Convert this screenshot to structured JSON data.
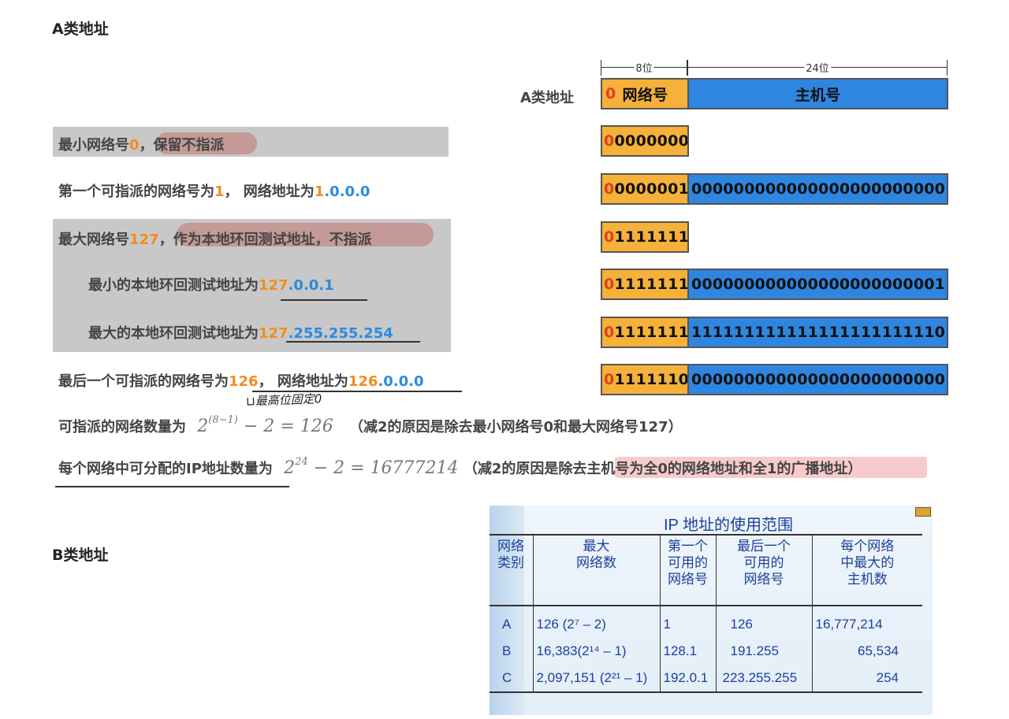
{
  "section_a_title": "A类地址",
  "section_b_title": "B类地址",
  "diagram": {
    "label": "A类地址",
    "dim_net": "8位",
    "dim_host": "24位",
    "header_net_prefix": "0",
    "header_net": "网络号",
    "header_host": "主机号",
    "rows": [
      {
        "net_first": "0",
        "net_rest": "0000000",
        "host": ""
      },
      {
        "net_first": "0",
        "net_rest": "0000001",
        "host": "000000000000000000000000"
      },
      {
        "net_first": "0",
        "net_rest": "1111111",
        "host": ""
      },
      {
        "net_first": "0",
        "net_rest": "1111111",
        "host": "000000000000000000000001"
      },
      {
        "net_first": "0",
        "net_rest": "1111111",
        "host": "111111111111111111111110"
      },
      {
        "net_first": "0",
        "net_rest": "1111110",
        "host": "000000000000000000000000"
      }
    ]
  },
  "lines": {
    "l1": {
      "a": "最小网络号",
      "b": "0",
      "c": "，",
      "d": "保留不指派"
    },
    "l2": {
      "a": "第一个可指派的网络号为",
      "b": "1",
      "c": "，  网络地址为",
      "d": "1",
      "e": ".0.0.0"
    },
    "l3": {
      "a": "最大网络号",
      "b": "127",
      "c": "，",
      "d": "作为本地环回测试地址，不指派"
    },
    "l4": {
      "a": "最小的本地环回测试地址为",
      "b": "127",
      "c": ".0.0.1"
    },
    "l5": {
      "a": "最大的本地环回测试地址为",
      "b": "127",
      "c": ".255.255.254"
    },
    "l6": {
      "a": "最后一个可指派的网络号为",
      "b": "126",
      "c": "，  网络地址为",
      "d": "126",
      "e": ".0.0.0"
    },
    "hand": "⊔最高位固定0",
    "l7": {
      "a": "可指派的网络数量为",
      "f_base": "2",
      "f_exp": "(8−1)",
      "f_rest": "− 2 = 126",
      "note": "（减2的原因是除去最小网络号0和最大网络号127）"
    },
    "l8": {
      "a": "每个网络中可分配的IP地址数量为",
      "f_base": "2",
      "f_exp": "24",
      "f_rest": "− 2 = 16777214",
      "note1": "（减2的原因是除去",
      "note2": "主机号为全0的网络地址和全1的广播地址",
      "note3": "）"
    }
  },
  "ip_table": {
    "title": "IP 地址的使用范围",
    "headers": [
      "网络\n类别",
      "最大\n网络数",
      "第一个\n可用的\n网络号",
      "最后一个\n可用的\n网络号",
      "每个网络\n中最大的\n主机数"
    ],
    "rows": [
      [
        "A",
        "126 (2⁷ – 2)",
        "1",
        "126",
        "16,777,214"
      ],
      [
        "B",
        "16,383(2¹⁴ – 1)",
        "128.1",
        "191.255",
        "65,534"
      ],
      [
        "C",
        "2,097,151 (2²¹ – 1)",
        "192.0.1",
        "223.255.255",
        "254"
      ]
    ]
  }
}
